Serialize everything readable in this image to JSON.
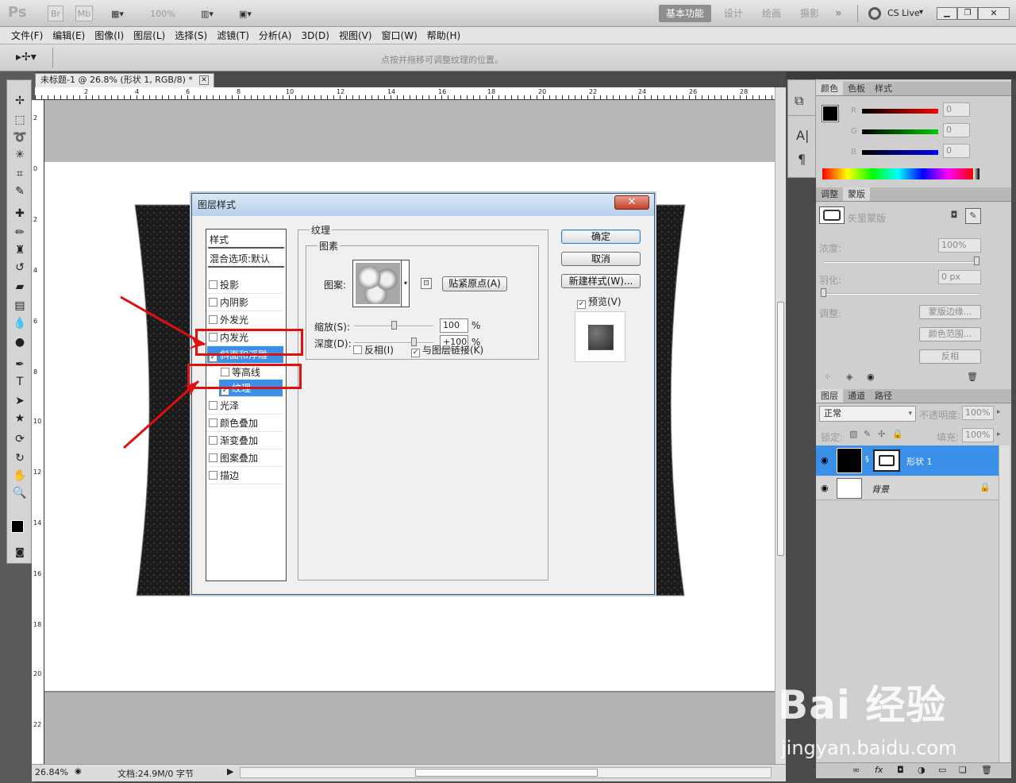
{
  "app": {
    "logo": "Ps",
    "icons": [
      "Br",
      "Mb"
    ],
    "zoom_box": "100%",
    "workspaces": [
      "基本功能",
      "设计",
      "绘画",
      "摄影"
    ],
    "more": "»",
    "cs_live": "CS Live"
  },
  "menus": [
    "文件(F)",
    "编辑(E)",
    "图像(I)",
    "图层(L)",
    "选择(S)",
    "滤镜(T)",
    "分析(A)",
    "3D(D)",
    "视图(V)",
    "窗口(W)",
    "帮助(H)"
  ],
  "options_hint": "点按并拖移可调整纹理的位置。",
  "document": {
    "tab_title": "未标题-1 @ 26.8% (形状 1, RGB/8) *",
    "ruler_top": [
      "2",
      "4",
      "6",
      "8",
      "10",
      "12",
      "14",
      "16",
      "18",
      "20",
      "22",
      "24",
      "26",
      "28"
    ],
    "ruler_left": [
      "2",
      "0",
      "2",
      "4",
      "6",
      "8",
      "10",
      "12",
      "14",
      "16",
      "18",
      "20",
      "22"
    ],
    "status_zoom": "26.84%",
    "status_doc": "文档:24.9M/0 字节"
  },
  "dialog": {
    "title": "图层样式",
    "close": "✕",
    "style_header": "样式",
    "blend_options": "混合选项:默认",
    "styles": [
      {
        "label": "投影",
        "checked": false
      },
      {
        "label": "内阴影",
        "checked": false
      },
      {
        "label": "外发光",
        "checked": false
      },
      {
        "label": "内发光",
        "checked": false
      },
      {
        "label": "斜面和浮雕",
        "checked": true
      },
      {
        "label": "等高线",
        "checked": false
      },
      {
        "label": "纹理",
        "checked": true
      },
      {
        "label": "光泽",
        "checked": false
      },
      {
        "label": "颜色叠加",
        "checked": false
      },
      {
        "label": "渐变叠加",
        "checked": false
      },
      {
        "label": "图案叠加",
        "checked": false
      },
      {
        "label": "描边",
        "checked": false
      }
    ],
    "texture_group": "纹理",
    "elements_group": "图素",
    "pattern_label": "图案:",
    "snap_origin": "贴紧原点(A)",
    "scale_label": "缩放(S):",
    "scale_value": "100",
    "scale_level_pct": 50,
    "depth_label": "深度(D):",
    "depth_value": "+100",
    "depth_level_pct": 75,
    "percent": "%",
    "invert_label": "反相(I)",
    "invert_checked": false,
    "link_label": "与图层链接(K)",
    "link_checked": true,
    "ok": "确定",
    "cancel": "取消",
    "new_style": "新建样式(W)...",
    "preview_label": "预览(V)",
    "preview_checked": true
  },
  "panels": {
    "color_tabs": [
      "颜色",
      "色板",
      "样式"
    ],
    "rgb_labels": [
      "R",
      "G",
      "B"
    ],
    "rgb_values": [
      "0",
      "0",
      "0"
    ],
    "mask_tabs": [
      "调整",
      "蒙版"
    ],
    "mask_title": "矢里蒙版",
    "density_label": "浓度:",
    "density_value": "100%",
    "feather_label": "羽化:",
    "feather_value": "0 px",
    "adjust_label": "调整:",
    "mask_edge": "蒙版边缘...",
    "color_range": "颜色范围...",
    "invert": "反相",
    "layer_tabs": [
      "图层",
      "通道",
      "路径"
    ],
    "blend_mode": "正常",
    "opacity_label": "不透明度:",
    "opacity_value": "100%",
    "lock_label": "锁定:",
    "fill_label": "填充:",
    "fill_value": "100%",
    "layers": [
      {
        "name": "形状 1",
        "selected": true
      },
      {
        "name": "背景",
        "selected": false
      }
    ]
  },
  "watermark": {
    "brand": "Bai 经验",
    "url": "jingyan.baidu.com"
  },
  "colors": {
    "accent": "#3a8fe8",
    "annotation": "#e01010",
    "canvas": "#b8b8b8"
  }
}
